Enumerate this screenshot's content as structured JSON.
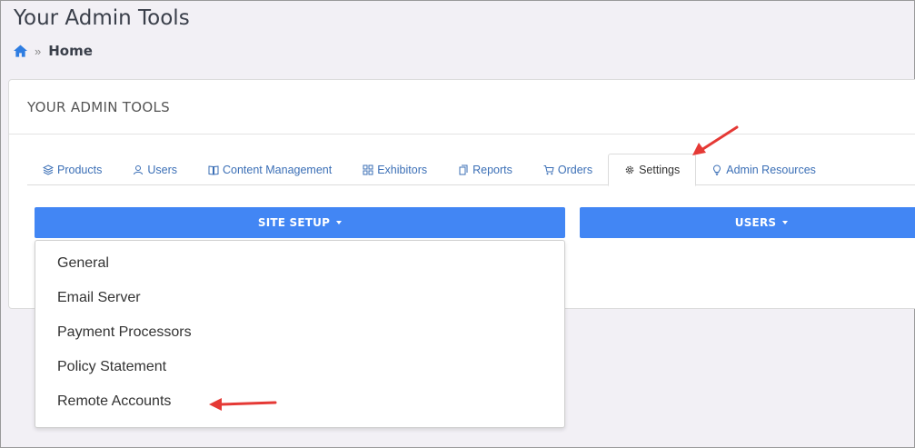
{
  "page": {
    "title": "Your Admin Tools"
  },
  "breadcrumb": {
    "icon": "home-icon",
    "separator": "»",
    "current": "Home"
  },
  "card": {
    "header": "YOUR ADMIN TOOLS"
  },
  "tabs": [
    {
      "label": "Products",
      "icon": "layers-icon"
    },
    {
      "label": "Users",
      "icon": "users-icon"
    },
    {
      "label": "Content Management",
      "icon": "book-icon"
    },
    {
      "label": "Exhibitors",
      "icon": "grid-icon"
    },
    {
      "label": "Reports",
      "icon": "file-icon"
    },
    {
      "label": "Orders",
      "icon": "cart-icon"
    },
    {
      "label": "Settings",
      "icon": "gear-icon",
      "active": true
    },
    {
      "label": "Admin Resources",
      "icon": "lightbulb-icon"
    }
  ],
  "buttons": {
    "site_setup": "SITE SETUP",
    "users": "USERS"
  },
  "dropdown": {
    "items": [
      "General",
      "Email Server",
      "Payment Processors",
      "Policy Statement",
      "Remote Accounts"
    ]
  },
  "colors": {
    "primary": "#4286f4",
    "link": "#3b6fb6",
    "annotation": "#e53935"
  }
}
